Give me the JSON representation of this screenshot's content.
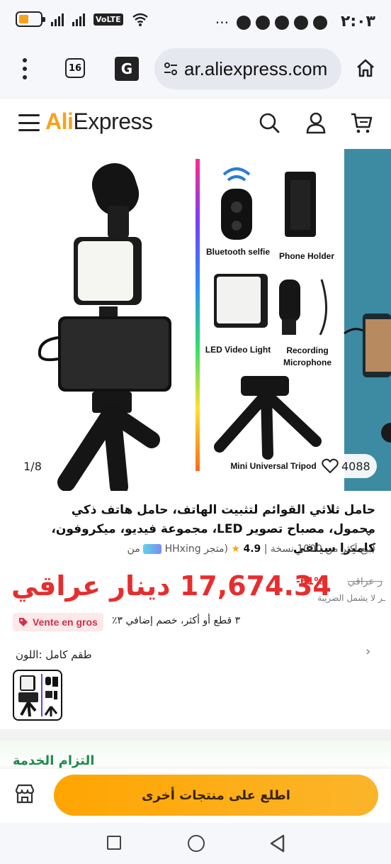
{
  "status_bar": {
    "time": "٢:٠٣",
    "network_badge": "VoLTE",
    "sim_label": "1 2"
  },
  "browser": {
    "tab_count": "16",
    "url": "ar.aliexpress.com",
    "translate_glyph": "G"
  },
  "site": {
    "logo_prefix": "Ali",
    "logo_suffix": "Express"
  },
  "gallery": {
    "counter": "1/8",
    "wishlist_count": "4088",
    "labels": {
      "bluetooth": "Bluetooth selfie",
      "phone_holder": "Phone Holder",
      "led_light": "LED Video Light",
      "microphone": "Recording Microphone",
      "tripod": "Mini Universal Tripod"
    }
  },
  "product": {
    "title": "حامل ثلاثي القوائم لتثبيت الهاتف، حامل هاتف ذكي محمول، مصباح تصوير LED، مجموعة فيديو، ميكروفون، كاميرا سيلفي",
    "sold": "(بيع أكثر من 1000 نسخة",
    "separator": "|",
    "rating": "4.9",
    "store_prefix": "(متجر",
    "store_name": "HHxing",
    "store_suffix": "من",
    "price": "17,674.34 دينار عراقي",
    "discount": "-61%",
    "old_price": "ر عراقي",
    "tax_note": "ـر لا يشمل الضريبة",
    "wholesale_label": "Vente en gros",
    "bulk_offer": "٣ قطع أو أكثر، خصم إضافي ٣٪",
    "color_label": "طقم كامل :اللون"
  },
  "service": {
    "title": "التزام الخدمة"
  },
  "bottom_bar": {
    "cta": "اطلع على منتجات أخرى"
  },
  "colors": {
    "accent": "#f7a21c",
    "price_red": "#e62e2e",
    "cta_orange": "#ffa502",
    "service_green": "#1f8a4c"
  }
}
